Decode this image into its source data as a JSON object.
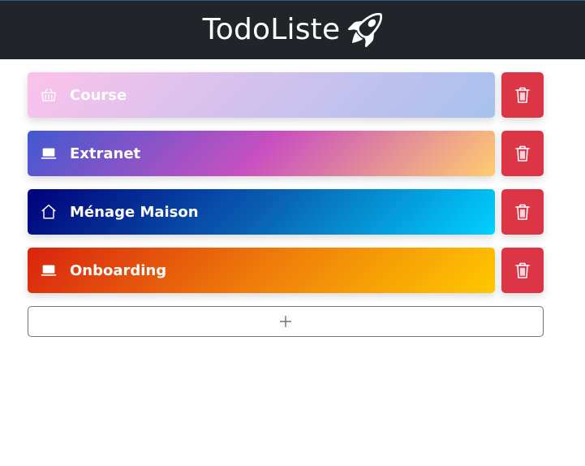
{
  "header": {
    "title": "TodoListe",
    "icon": "rocket-icon"
  },
  "lists": [
    {
      "label": "Course",
      "icon": "basket-icon",
      "gradient": [
        "#fbc2eb",
        "#a6c1ee"
      ]
    },
    {
      "label": "Extranet",
      "icon": "laptop-icon",
      "gradient": [
        "#4158d0",
        "#c850c0",
        "#ffcc70"
      ]
    },
    {
      "label": "Ménage Maison",
      "icon": "house-icon",
      "gradient": [
        "#00007a",
        "#0a5fb4",
        "#00d2ff"
      ]
    },
    {
      "label": "Onboarding",
      "icon": "laptop-icon",
      "gradient": [
        "#d9230f",
        "#ee7b0a",
        "#ffc800"
      ]
    }
  ],
  "delete_button": {
    "icon": "trash-icon",
    "color": "#dc3545"
  },
  "add_button": {
    "icon": "plus-icon",
    "border_color": "#6c757d"
  }
}
